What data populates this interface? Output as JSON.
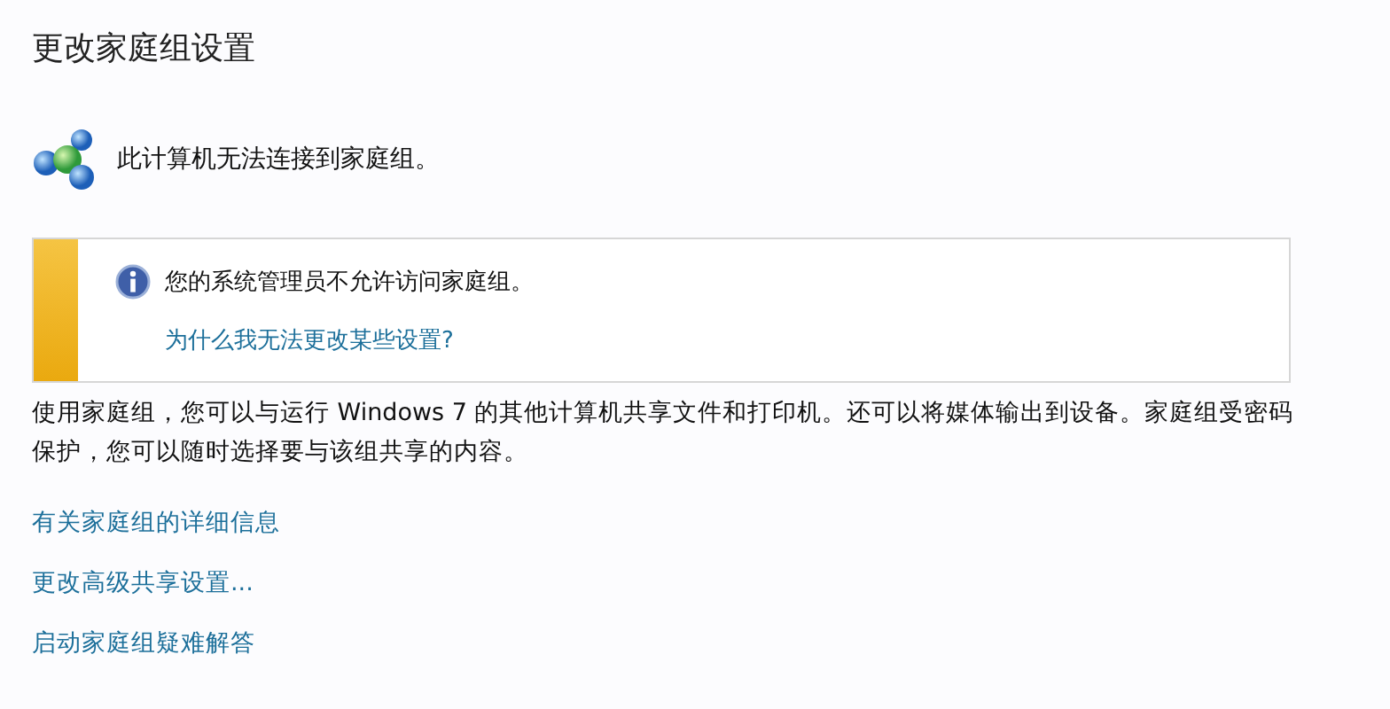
{
  "title": "更改家庭组设置",
  "status": {
    "text": "此计算机无法连接到家庭组。"
  },
  "notice": {
    "message": "您的系统管理员不允许访问家庭组。",
    "link": "为什么我无法更改某些设置?"
  },
  "description": "使用家庭组，您可以与运行 Windows 7 的其他计算机共享文件和打印机。还可以将媒体输出到设备。家庭组受密码保护，您可以随时选择要与该组共享的内容。",
  "links": [
    "有关家庭组的详细信息",
    "更改高级共享设置...",
    "启动家庭组疑难解答"
  ]
}
